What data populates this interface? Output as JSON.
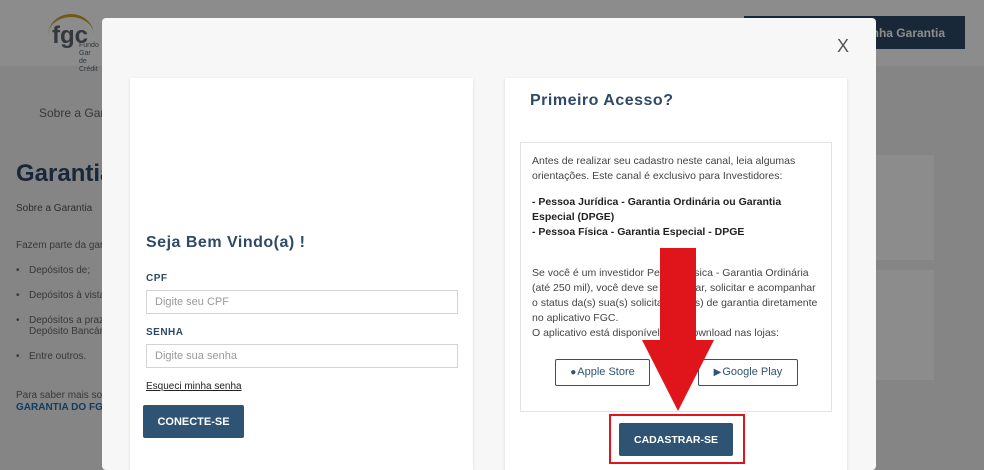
{
  "header": {
    "logo_text": "fgc",
    "logo_sub_line1": "Fundo Gar",
    "logo_sub_line2": "de Crédit",
    "button_label": "Minha Garantia"
  },
  "background": {
    "nav_item": "Sobre a Garan",
    "title": "Garantia G",
    "subtitle": "Sobre a Garantia",
    "intro": "Fazem parte da gara",
    "list": [
      "Depósitos de;",
      "Depósitos à vista c",
      "Depósitos a prazo",
      "Entre outros."
    ],
    "list_sub": "Depósito Bancário",
    "more_text": "Para saber mais sobr",
    "more_link": "GARANTIA DO FGC."
  },
  "modal": {
    "close_label": "X",
    "login": {
      "welcome": "Seja Bem Vindo(a) !",
      "cpf_label": "CPF",
      "cpf_placeholder": "Digite seu CPF",
      "password_label": "SENHA",
      "password_placeholder": "Digite sua senha",
      "forgot_label": "Esqueci minha senha",
      "connect_label": "CONECTE-SE"
    },
    "first_access": {
      "title": "Primeiro Acesso?",
      "intro": "Antes de realizar seu cadastro neste canal, leia algumas orientações. Este canal é exclusivo para Investidores:",
      "bold_line1": "- Pessoa Jurídica - Garantia Ordinária ou Garantia Especial (DPGE)",
      "bold_line2": "- Pessoa Física - Garantia Especial - DPGE",
      "body": "Se você é um investidor Pessoa Física - Garantia Ordinária (até 250 mil), você deve se cadastrar, solicitar e acompanhar o status da(s) sua(s) solicitação(ões) de garantia diretamente no aplicativo FGC.",
      "body2": "O aplicativo está disponível para download nas lojas:",
      "apple_label": "Apple Store",
      "google_label": "Google Play",
      "register_label": "CADASTRAR-SE"
    }
  },
  "colors": {
    "brand_dark": "#2f4a66",
    "button_primary": "#2f5473",
    "highlight_red": "#e0151b"
  }
}
